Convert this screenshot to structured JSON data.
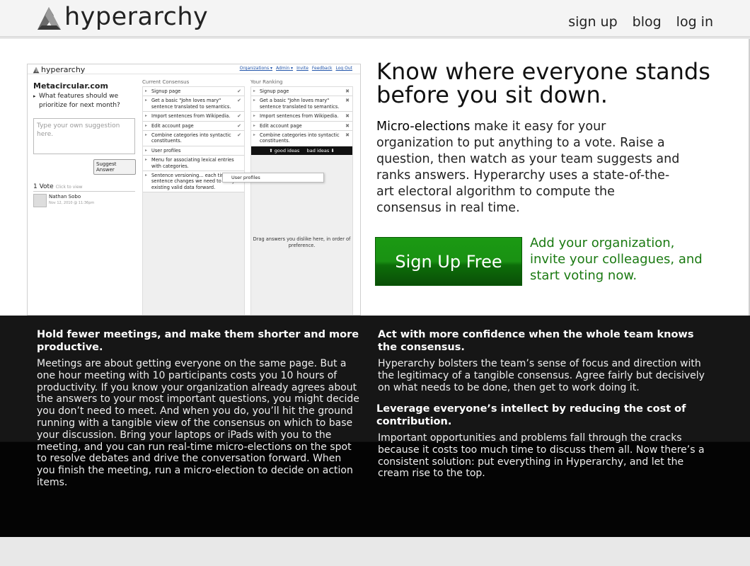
{
  "header": {
    "logo_text": "hyperarchy",
    "nav": [
      "sign up",
      "blog",
      "log in"
    ]
  },
  "screenshot": {
    "logo_text": "hyperarchy",
    "links": [
      "Organizations ▾",
      "Admin ▾",
      "Invite",
      "Feedback",
      "Log Out"
    ],
    "org_name": "Metacircular.com",
    "question": "What features should we prioritize for next month?",
    "input_placeholder": "Type your own suggestion here.",
    "suggest_button": "Suggest Answer",
    "vote_count": "1 Vote",
    "vote_click": "Click to view",
    "voter_name": "Nathan Sobo",
    "voter_date": "Nov 12, 2010 @ 11:36pm",
    "current_title": "Current Consensus",
    "ranking_title": "Your Ranking",
    "current_items": [
      "Signup page",
      "Get a basic \"John loves mary\" sentence translated to semantics.",
      "Import sentences from Wikipedia.",
      "Edit account page",
      "Combine categories into syntactic constituents.",
      "User profiles",
      "Menu for associating lexical entries with categories.",
      "Sentence versioning... each time a sentence changes we need to carry existing valid data forward."
    ],
    "ranking_items": [
      "Signup page",
      "Get a basic \"John loves mary\" sentence translated to semantics.",
      "Import sentences from Wikipedia.",
      "Edit account page",
      "Combine categories into syntactic constituents."
    ],
    "good_ideas": "good ideas",
    "bad_ideas": "bad ideas",
    "drag_text": "Drag answers you dislike here, in order of preference.",
    "drag_ghost": "User profiles"
  },
  "hero": {
    "headline": "Know where everyone stands before you sit down.",
    "desc_strong": "Micro-elections",
    "desc_rest": " make it easy for your organization to put anything to a vote. Raise a question, then watch as your team suggests and ranks answers. Hyperarchy uses a state-of-the-art electoral algorithm to compute the consensus in real time.",
    "signup_button": "Sign Up Free",
    "cta_text": "Add your organization, invite your colleagues, and start voting now."
  },
  "features": [
    {
      "title": "Hold fewer meetings, and make them shorter and more productive.",
      "body": "Meetings are about getting everyone on the same page. But a one hour meeting with 10 participants costs you 10 hours of productivity. If you know your organization already agrees about the answers to your most important questions, you might decide you don’t need to meet. And when you do, you’ll hit the ground running with a tangible view of the consensus on which to base your discussion. Bring your laptops or iPads with you to the meeting, and you can run real-time micro-elections on the spot to resolve debates and drive the conversation forward. When you finish the meeting, run a micro-election to decide on action items."
    },
    {
      "title": "Act with more confidence when the whole team knows the consensus.",
      "body": "Hyperarchy bolsters the team’s sense of focus and direction with the legitimacy of a tangible consensus. Agree fairly but decisively on what needs to be done, then get to work doing it."
    },
    {
      "title": "Leverage everyone’s intellect by reducing the cost of contribution.",
      "body": "Important opportunities and problems fall through the cracks because it costs too much time to discuss them all. Now there’s a consistent solution: put everything in Hyperarchy, and let the cream rise to the top."
    }
  ]
}
